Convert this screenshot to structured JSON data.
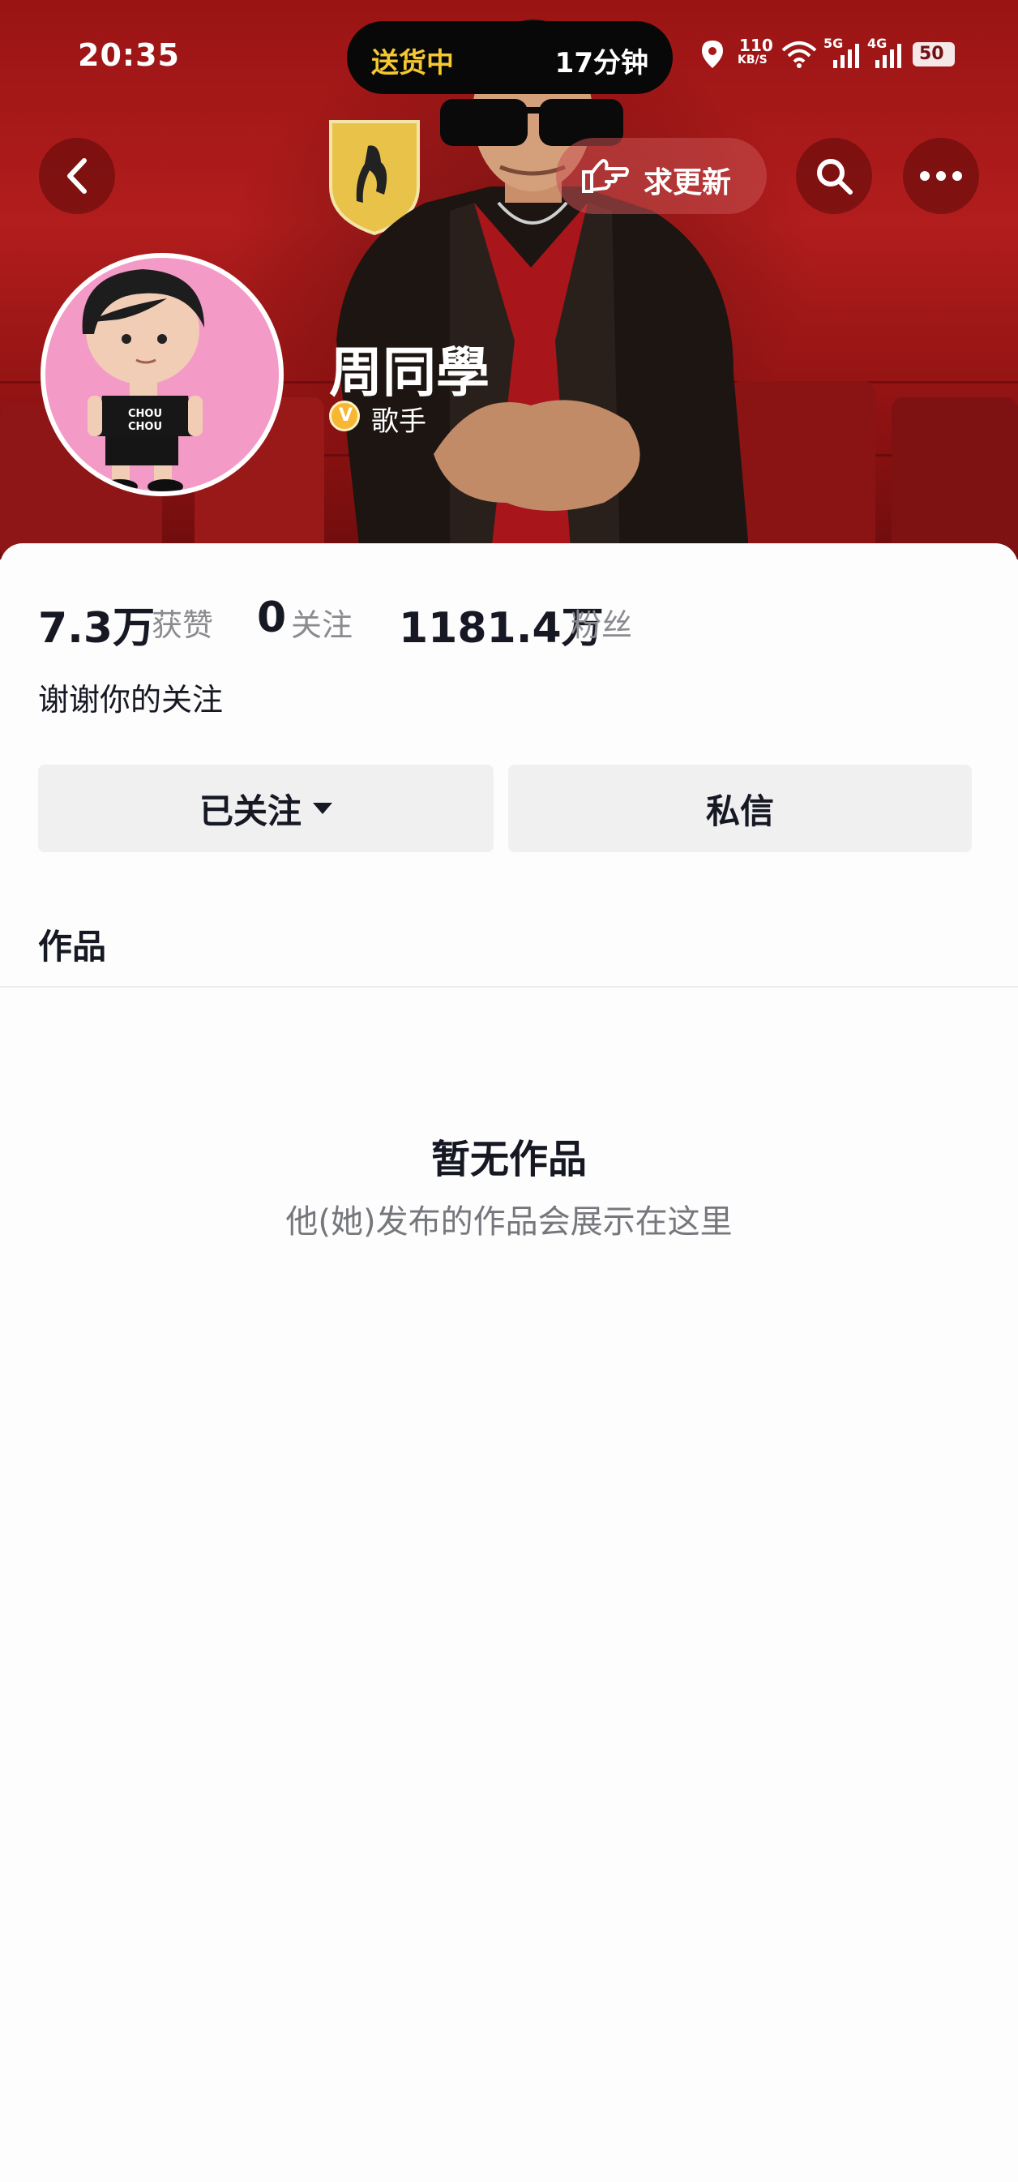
{
  "status_bar": {
    "time": "20:35",
    "island_left": "送货中",
    "island_right": "17分钟",
    "net_speed_top": "110",
    "net_speed_bottom": "KB/S",
    "sim1": "5G",
    "sim2": "4G",
    "battery": "50",
    "icons": [
      "location-icon",
      "wifi-icon",
      "signal-5g-icon",
      "signal-4g-icon",
      "battery-icon"
    ]
  },
  "top_bar": {
    "request_update_label": "求更新",
    "icons": [
      "back-icon",
      "finger-point-icon",
      "search-icon",
      "more-icon"
    ]
  },
  "profile": {
    "name": "周同學",
    "role": "歌手",
    "badge": "V"
  },
  "stats": {
    "likes_count": "7.3万",
    "likes_label": "获赞",
    "following_count": "0",
    "following_label": "关注",
    "followers_count": "1181.4万",
    "followers_label": "粉丝"
  },
  "bio": "谢谢你的关注",
  "actions": {
    "follow_label": "已关注",
    "message_label": "私信"
  },
  "tabs": {
    "works_label": "作品"
  },
  "empty_state": {
    "title": "暂无作品",
    "subtitle": "他(她)发布的作品会展示在这里"
  },
  "colors": {
    "header_red": "#b21d1d",
    "island_text": "#f5c731",
    "badge_gold": "#f7b733",
    "avatar_bg": "#f39bc6",
    "button_bg": "#f0f0f1"
  }
}
